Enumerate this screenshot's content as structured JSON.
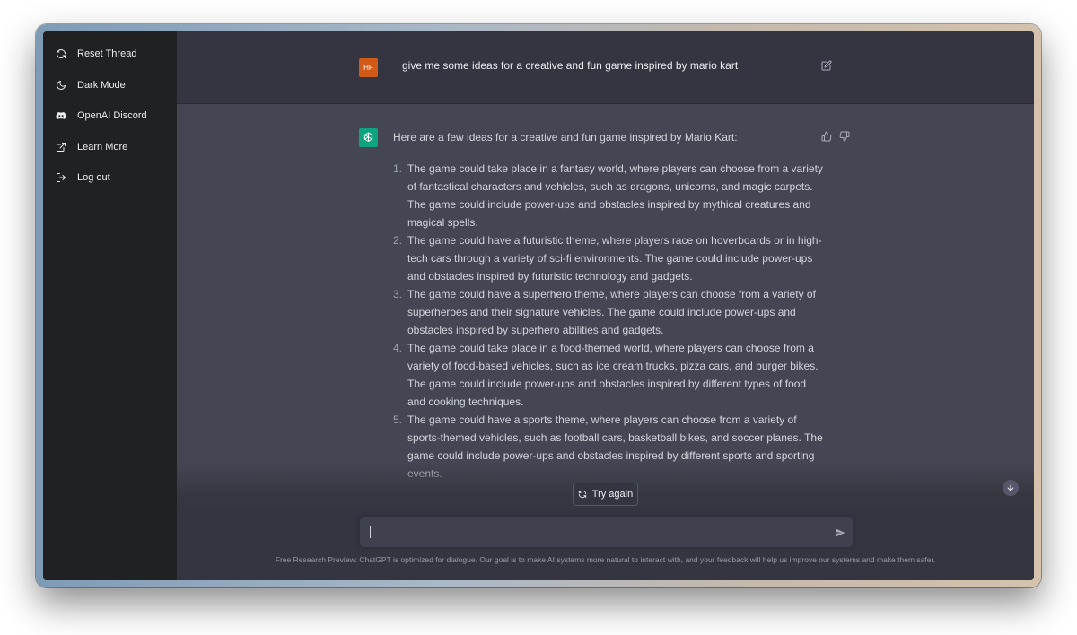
{
  "sidebar": {
    "items": [
      {
        "label": "Reset Thread",
        "icon": "refresh-icon"
      },
      {
        "label": "Dark Mode",
        "icon": "moon-icon"
      },
      {
        "label": "OpenAI Discord",
        "icon": "discord-icon"
      },
      {
        "label": "Learn More",
        "icon": "external-link-icon"
      },
      {
        "label": "Log out",
        "icon": "logout-icon"
      }
    ]
  },
  "conversation": {
    "user": {
      "avatar_initials": "HF",
      "avatar_color": "#d05a16",
      "message": "give me some ideas for a creative and fun game inspired by mario kart"
    },
    "assistant": {
      "avatar_color": "#10a37f",
      "intro": "Here are a few ideas for a creative and fun game inspired by Mario Kart:",
      "items": [
        {
          "number": "1.",
          "text": "The game could take place in a fantasy world, where players can choose from a variety of fantastical characters and vehicles, such as dragons, unicorns, and magic carpets. The game could include power-ups and obstacles inspired by mythical creatures and magical spells."
        },
        {
          "number": "2.",
          "text": "The game could have a futuristic theme, where players race on hoverboards or in high-tech cars through a variety of sci-fi environments. The game could include power-ups and obstacles inspired by futuristic technology and gadgets."
        },
        {
          "number": "3.",
          "text": "The game could have a superhero theme, where players can choose from a variety of superheroes and their signature vehicles. The game could include power-ups and obstacles inspired by superhero abilities and gadgets."
        },
        {
          "number": "4.",
          "text": "The game could take place in a food-themed world, where players can choose from a variety of food-based vehicles, such as ice cream trucks, pizza cars, and burger bikes. The game could include power-ups and obstacles inspired by different types of food and cooking techniques."
        },
        {
          "number": "5.",
          "text": "The game could have a sports theme, where players can choose from a variety of sports-themed vehicles, such as football cars, basketball bikes, and soccer planes. The game could include power-ups and obstacles inspired by different sports and sporting events."
        }
      ]
    }
  },
  "controls": {
    "try_again_label": "Try again",
    "input_value": "",
    "input_placeholder": ""
  },
  "footer": {
    "note": "Free Research Preview: ChatGPT is optimized for dialogue. Our goal is to make AI systems more natural to interact with, and your feedback will help us improve our systems and make them safer."
  },
  "colors": {
    "sidebar_bg": "#202123",
    "main_bg": "#343541",
    "assistant_bg": "#444654",
    "text": "#d1d5db"
  }
}
